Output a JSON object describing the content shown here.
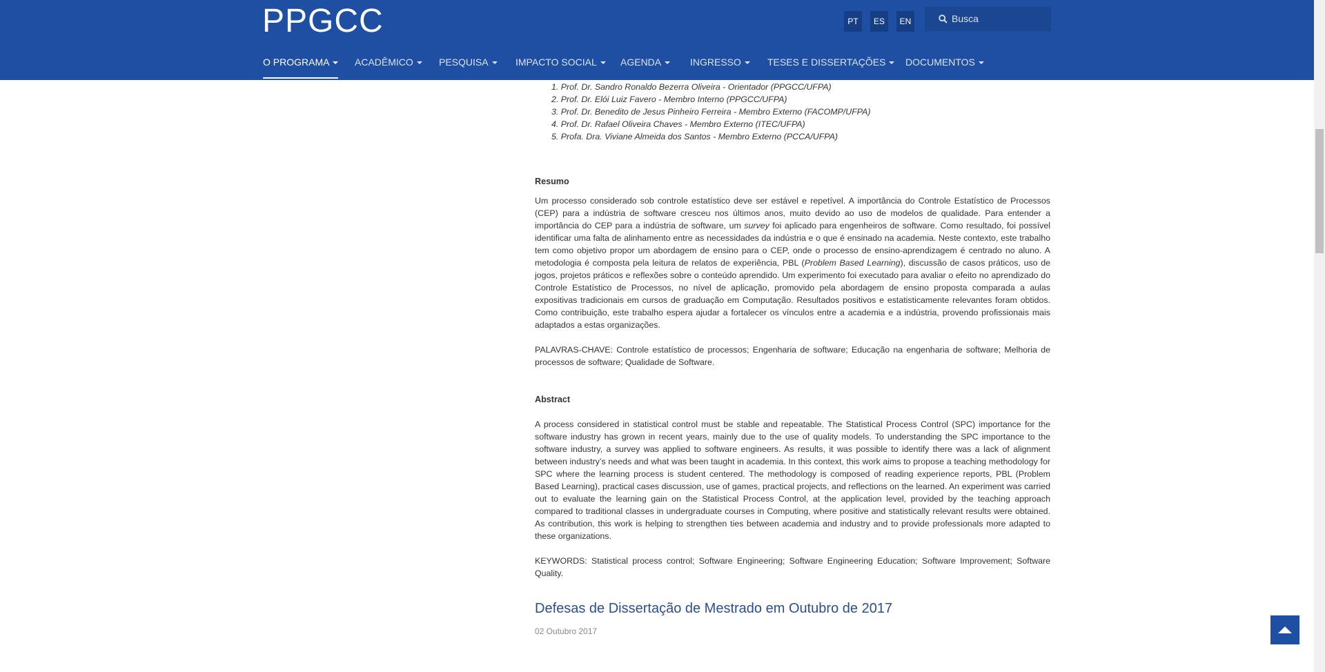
{
  "site": {
    "logo": "PPGCC"
  },
  "languages": [
    "PT",
    "ES",
    "EN"
  ],
  "search": {
    "placeholder": "Busca"
  },
  "nav": [
    {
      "label": "O PROGRAMA",
      "active": true
    },
    {
      "label": "ACADÊMICO"
    },
    {
      "label": "PESQUISA"
    },
    {
      "label": "IMPACTO SOCIAL"
    },
    {
      "label": "AGENDA"
    },
    {
      "label": "INGRESSO"
    },
    {
      "label": "TESES E DISSERTAÇÕES"
    },
    {
      "label": "DOCUMENTOS"
    }
  ],
  "committee": [
    "1. Prof. Dr. Sandro Ronaldo Bezerra Oliveira - Orientador (PPGCC/UFPA)",
    "2. Prof. Dr. Elói Luiz Favero - Membro Interno (PPGCC/UFPA)",
    "3. Prof. Dr. Benedito de Jesus Pinheiro Ferreira - Membro Externo (FACOMP/UFPA)",
    "4. Prof. Dr. Rafael Oliveira Chaves - Membro Externo (ITEC/UFPA)",
    "5. Profa. Dra. Viviane Almeida dos Santos - Membro Externo  (PCCA/UFPA)"
  ],
  "resumo": {
    "title": "Resumo",
    "text_before_survey": "Um processo considerado sob controle estatístico deve ser estável e repetível. A importância do Controle Estatístico de Processos (CEP) para a indústria de software cresceu nos últimos anos, muito devido ao uso de modelos de qualidade. Para entender a importância do CEP para a indústria de software, um ",
    "survey": "survey",
    "text_after_survey": " foi aplicado para engenheiros de software. Como resultado, foi possível identificar uma falta de alinhamento entre as necessidades da indústria e o que é ensinado na academia. Neste contexto, este trabalho tem como objetivo propor um abordagem de ensino para o CEP, onde o processo de ensino-aprendizagem é centrado no aluno. A metodologia é composta pela leitura de relatos de experiência, PBL (",
    "pbl": "Problem Based Learning",
    "text_end": "), discussão de casos práticos, uso de jogos, projetos práticos e reflexões sobre o conteúdo aprendido. Um experimento foi executado para avaliar o efeito no aprendizado do Controle Estatístico de Processos, no nível de aplicação, promovido pela abordagem de ensino proposta comparada a aulas expositivas tradicionais em cursos de graduação em Computação. Resultados positivos e estatisticamente relevantes foram obtidos. Como contribuição, este trabalho espera ajudar a fortalecer os vínculos entre a academia e a indústria, provendo profissionais mais adaptados a estas organizações.",
    "keywords": "PALAVRAS-CHAVE: Controle estatístico de processos; Engenharia de software; Educação na engenharia de software; Melhoria de processos de software; Qualidade de Software."
  },
  "abstract": {
    "title": "Abstract",
    "text": "A process considered in statistical control must be stable and repeatable. The Statistical Process Control (SPC) importance for the software industry has grown in recent years, mainly due to the use of quality models. To understanding the SPC importance to the software industry, a survey was applied to software engineers. As results, it was possible to identify there was a lack of alignment between industry’s needs and what was been taught in academia. In this context, this work aims to propose a teaching methodology for SPC where the learning process is student centered. The methodology is composed of reading experience reports, PBL (Problem Based Learning), practical cases discussion, use of games, practical projects, and reflections on the learned. An experiment was carried out to evaluate the learning gain on the Statistical Process Control, at the application level, provided by the teaching approach compared to traditional classes in undergraduate courses in Computing, where positive and statistically relevant results were obtained. As contribution, this work is helping to strengthen ties between academia and industry and to provide professionals more adapted to these organizations.",
    "keywords": "KEYWORDS: Statistical process control; Software Engineering; Software Engineering Education; Software Improvement; Software Quality."
  },
  "next_article": {
    "title": "Defesas de Dissertação de Mestrado em Outubro de 2017",
    "date": "02 Outubro 2017"
  },
  "colors": {
    "header": "#1f4fa3",
    "link": "#2a4f8f"
  }
}
